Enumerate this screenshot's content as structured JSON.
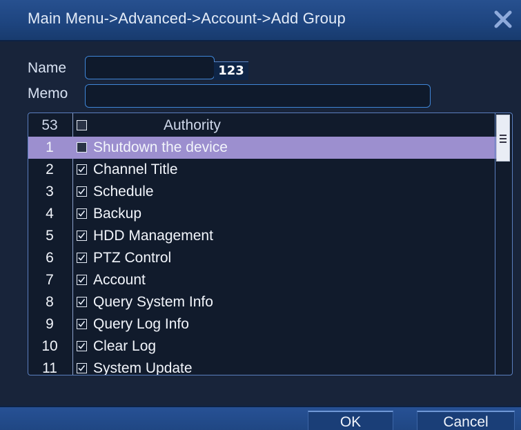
{
  "window": {
    "title": "Main Menu->Advanced->Account->Add Group"
  },
  "form": {
    "name_label": "Name",
    "name_value": "",
    "keyboard_label": "123",
    "memo_label": "Memo",
    "memo_value": ""
  },
  "table": {
    "header": {
      "count": "53",
      "title": "Authority",
      "checked": false
    },
    "rows": [
      {
        "index": "1",
        "label": "Shutdown the device",
        "checked": false,
        "selected": true
      },
      {
        "index": "2",
        "label": "Channel Title",
        "checked": true
      },
      {
        "index": "3",
        "label": "Schedule",
        "checked": true
      },
      {
        "index": "4",
        "label": "Backup",
        "checked": true
      },
      {
        "index": "5",
        "label": "HDD Management",
        "checked": true
      },
      {
        "index": "6",
        "label": "PTZ Control",
        "checked": true
      },
      {
        "index": "7",
        "label": "Account",
        "checked": true
      },
      {
        "index": "8",
        "label": "Query System Info",
        "checked": true
      },
      {
        "index": "9",
        "label": "Query Log Info",
        "checked": true
      },
      {
        "index": "10",
        "label": "Clear Log",
        "checked": true
      },
      {
        "index": "11",
        "label": "System Update",
        "checked": true
      }
    ]
  },
  "buttons": {
    "ok": "OK",
    "cancel": "Cancel"
  },
  "icons": {
    "close": "close-icon",
    "checkbox_checked": "check-icon",
    "scroll_thumb": "grip-icon"
  },
  "colors": {
    "title_bar": "#1f4580",
    "selected_row": "#9c8fcf",
    "input_border": "#3f86d8"
  }
}
